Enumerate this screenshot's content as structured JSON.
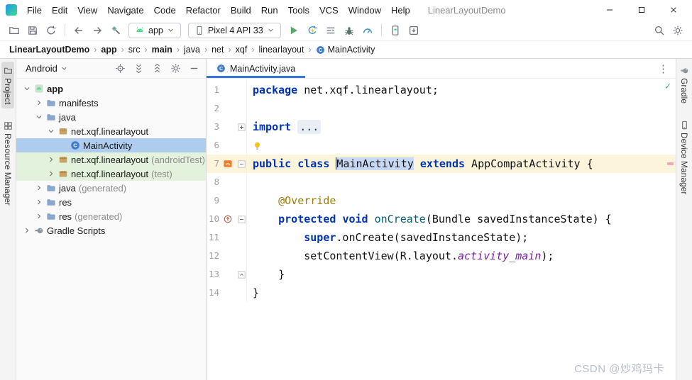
{
  "colors": {
    "accent": "#3874D9",
    "keyword": "#0033B3",
    "annotation": "#9E7D0A",
    "method": "#00627A",
    "static_field": "#7A1FA2",
    "selection_blue": "#AECCEE",
    "test_green": "#E3F2DC",
    "current_line": "#FCF5DC",
    "word_highlight": "#C8D9F6",
    "run_green": "#59A869"
  },
  "window": {
    "title": "LinearLayoutDemo",
    "menus": [
      "File",
      "Edit",
      "View",
      "Navigate",
      "Code",
      "Refactor",
      "Build",
      "Run",
      "Tools",
      "VCS",
      "Window",
      "Help"
    ],
    "controls": [
      "minimize-icon",
      "maximize-icon",
      "close-icon"
    ]
  },
  "toolbar": {
    "file_icons": [
      "open-icon",
      "save-icon",
      "sync-icon"
    ],
    "nav_icons": [
      "back-icon",
      "forward-icon",
      "build-hammer-icon"
    ],
    "run_config": {
      "icon": "android-icon",
      "label": "app"
    },
    "device_selector": {
      "icon": "device-phone-icon",
      "label": "Pixel 4 API 33"
    },
    "action_icons": [
      "run-icon",
      "apply-changes-icon",
      "attach-debugger-icon",
      "debug-icon",
      "profiler-icon"
    ],
    "device_icons": [
      "device-manager-icon",
      "sdk-manager-icon"
    ],
    "right_icons": [
      "search-icon",
      "settings-icon"
    ]
  },
  "breadcrumbs": {
    "separator": "›",
    "items": [
      {
        "label": "LinearLayoutDemo",
        "bold": true
      },
      {
        "label": "app",
        "bold": true
      },
      {
        "label": "src"
      },
      {
        "label": "main",
        "bold": true
      },
      {
        "label": "java"
      },
      {
        "label": "net"
      },
      {
        "label": "xqf"
      },
      {
        "label": "linearlayout"
      },
      {
        "label": "MainActivity",
        "icon": "class-icon"
      }
    ]
  },
  "left_strip": {
    "items": [
      {
        "label": "Project",
        "icon": "project-icon",
        "active": true
      },
      {
        "label": "Resource Manager",
        "icon": "resource-manager-icon",
        "active": false
      }
    ]
  },
  "right_strip": {
    "items": [
      {
        "label": "Gradle",
        "icon": "gradle-icon",
        "active": false
      },
      {
        "label": "Device Manager",
        "icon": "device-manager-tool-icon",
        "active": false
      }
    ]
  },
  "project_panel": {
    "view_selector": "Android",
    "header_icons": [
      "locate-icon",
      "expand-all-icon",
      "collapse-all-icon",
      "settings-gear-icon",
      "hide-panel-icon"
    ],
    "tree": [
      {
        "label": "app",
        "depth": 0,
        "chevron": "down",
        "icon": "app-module-icon",
        "bold": true
      },
      {
        "label": "manifests",
        "depth": 1,
        "chevron": "right",
        "icon": "folder-icon"
      },
      {
        "label": "java",
        "depth": 1,
        "chevron": "down",
        "icon": "folder-icon"
      },
      {
        "label": "net.xqf.linearlayout",
        "depth": 2,
        "chevron": "down",
        "icon": "package-icon"
      },
      {
        "label": "MainActivity",
        "depth": 3,
        "icon": "class-icon",
        "selected": true
      },
      {
        "label": "net.xqf.linearlayout",
        "suffix": " (androidTest)",
        "depth": 2,
        "chevron": "right",
        "icon": "package-icon",
        "highlight": "test"
      },
      {
        "label": "net.xqf.linearlayout",
        "suffix": " (test)",
        "depth": 2,
        "chevron": "right",
        "icon": "package-icon",
        "highlight": "test"
      },
      {
        "label": "java",
        "suffix": " (generated)",
        "depth": 1,
        "chevron": "right",
        "icon": "folder-icon"
      },
      {
        "label": "res",
        "depth": 1,
        "chevron": "right",
        "icon": "folder-icon"
      },
      {
        "label": "res",
        "suffix": " (generated)",
        "depth": 1,
        "chevron": "right",
        "icon": "folder-icon"
      },
      {
        "label": "Gradle Scripts",
        "depth": 0,
        "chevron": "right",
        "icon": "gradle-icon"
      }
    ]
  },
  "editor": {
    "tab": {
      "label": "MainActivity.java",
      "icon": "class-icon"
    },
    "more_icon": "⋮",
    "inspection_check": "✓",
    "lines": [
      {
        "num": "1",
        "tokens": [
          {
            "t": "package",
            "c": "kw"
          },
          {
            "t": " net.xqf.linearlayout;",
            "c": "pl"
          }
        ]
      },
      {
        "num": "2",
        "tokens": []
      },
      {
        "num": "3",
        "fold": "plus",
        "tokens": [
          {
            "t": "import",
            "c": "kw"
          },
          {
            "t": " ",
            "c": "pl"
          },
          {
            "t": "...",
            "c": "fold"
          }
        ]
      },
      {
        "num": "6",
        "bulb": true,
        "tokens": []
      },
      {
        "num": "7",
        "current": true,
        "gutter": "layout-gutter-icon",
        "fold": "minus",
        "tokens": [
          {
            "t": "public class ",
            "c": "kw"
          },
          {
            "caret": true
          },
          {
            "t": "MainActivity",
            "c": "hl"
          },
          {
            "t": " ",
            "c": "pl"
          },
          {
            "t": "extends",
            "c": "kw"
          },
          {
            "t": " AppCompatActivity {",
            "c": "pl"
          }
        ]
      },
      {
        "num": "8",
        "tokens": []
      },
      {
        "num": "9",
        "tokens": [
          {
            "t": "    ",
            "c": "pl"
          },
          {
            "t": "@Override",
            "c": "ann"
          }
        ]
      },
      {
        "num": "10",
        "gutter": "override-icon",
        "fold": "minus",
        "tokens": [
          {
            "t": "    ",
            "c": "pl"
          },
          {
            "t": "protected",
            "c": "kw"
          },
          {
            "t": " ",
            "c": "pl"
          },
          {
            "t": "void",
            "c": "kw"
          },
          {
            "t": " ",
            "c": "pl"
          },
          {
            "t": "onCreate",
            "c": "mth"
          },
          {
            "t": "(Bundle savedInstanceState) {",
            "c": "pl"
          }
        ]
      },
      {
        "num": "11",
        "tokens": [
          {
            "t": "        ",
            "c": "pl"
          },
          {
            "t": "super",
            "c": "kw"
          },
          {
            "t": ".onCreate(savedInstanceState);",
            "c": "pl"
          }
        ]
      },
      {
        "num": "12",
        "tokens": [
          {
            "t": "        setContentView(R.layout.",
            "c": "pl"
          },
          {
            "t": "activity_main",
            "c": "static"
          },
          {
            "t": ");",
            "c": "pl"
          }
        ]
      },
      {
        "num": "13",
        "fold": "end",
        "tokens": [
          {
            "t": "    }",
            "c": "pl"
          }
        ]
      },
      {
        "num": "14",
        "tokens": [
          {
            "t": "}",
            "c": "pl"
          }
        ]
      }
    ]
  },
  "watermark": {
    "text": "CSDN @炒鸡玛卡"
  }
}
